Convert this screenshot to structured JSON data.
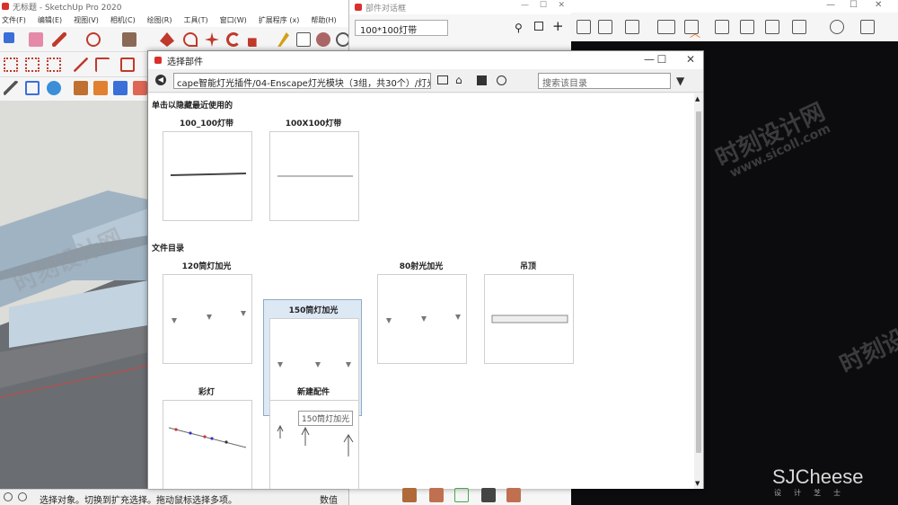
{
  "sketchup": {
    "title": "无标题 - SketchUp Pro 2020",
    "menu": [
      "文件(F)",
      "编辑(E)",
      "视图(V)",
      "相机(C)",
      "绘图(R)",
      "工具(T)",
      "窗口(W)",
      "扩展程序 (x)",
      "帮助(H)"
    ],
    "status_text": "选择对象。切换到扩充选择。拖动鼠标选择多项。",
    "value_label": "数值"
  },
  "component_browser": {
    "title": "部件对话框",
    "search_value": "100*100灯带"
  },
  "dialog": {
    "title": "选择部件",
    "path": "cape智能灯光插件/04-Enscape灯光模块（3组，共30个）/灯光",
    "search_placeholder": "搜索该目录",
    "recent_heading": "单击以隐藏最近使用的",
    "folder_heading": "文件目录",
    "recent": [
      {
        "label": "100_100灯带"
      },
      {
        "label": "100X100灯带"
      }
    ],
    "folder": [
      {
        "label": "120筒灯加光"
      },
      {
        "label": "150筒灯加光"
      },
      {
        "label": "80射光加光"
      },
      {
        "label": "吊顶"
      },
      {
        "label": "彩灯"
      },
      {
        "label": "新建配件"
      }
    ],
    "tooltip": "150筒灯加光"
  },
  "watermark": {
    "brand": "SJCheese",
    "brand_sub": "设计芝士",
    "site": "时刻设计网",
    "url": "www.sicoll.com"
  }
}
